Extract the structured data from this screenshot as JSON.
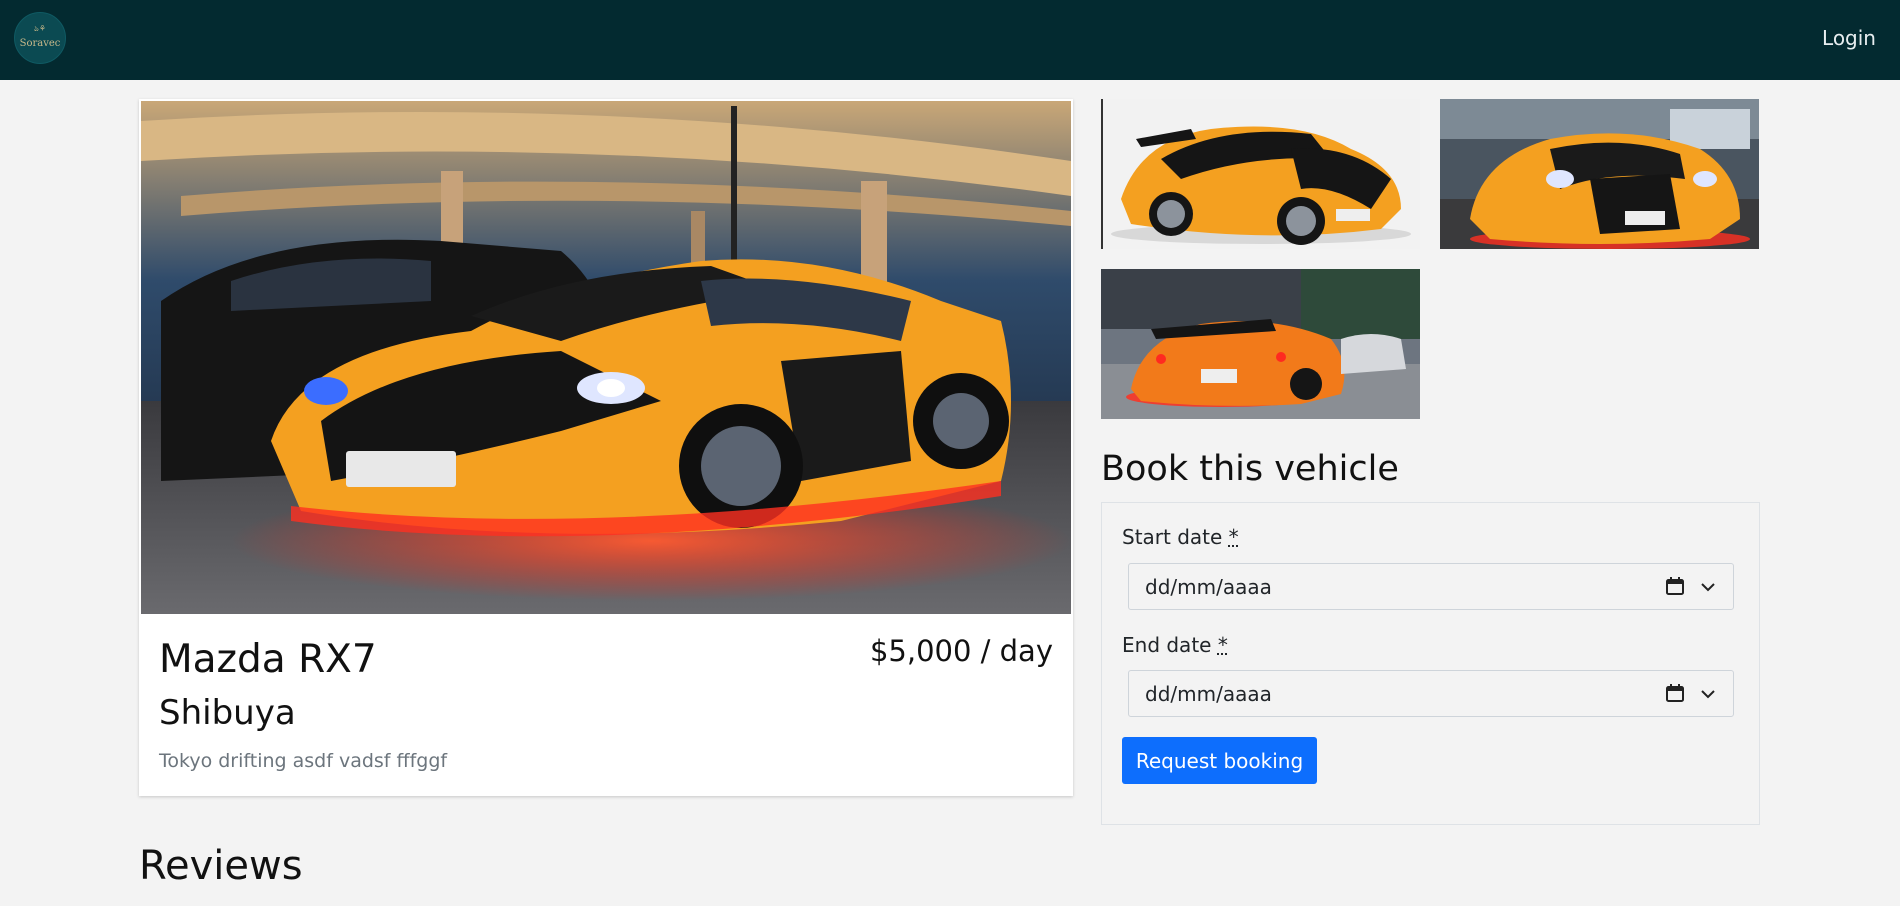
{
  "nav": {
    "logo_text": "Soravec",
    "logo_mark": "ঌ⚘",
    "login_label": "Login"
  },
  "listing": {
    "title": "Mazda RX7",
    "price": "$5,000 / day",
    "location": "Shibuya",
    "description": "Tokyo drifting asdf vadsf fffggf"
  },
  "booking": {
    "heading": "Book this vehicle",
    "start_label": "Start date",
    "end_label": "End date",
    "required_mark": "*",
    "start_value": "dd/mm/aaaa",
    "end_value": "dd/mm/aaaa",
    "submit_label": "Request booking"
  },
  "reviews": {
    "heading": "Reviews"
  },
  "icons": {
    "date_picker": "calendar-icon",
    "dropdown": "chevron-down-icon"
  },
  "colors": {
    "navbar": "#032a30",
    "primary_button": "#0d6efd",
    "car_orange": "#f4a020",
    "underglow": "#ff3020"
  }
}
